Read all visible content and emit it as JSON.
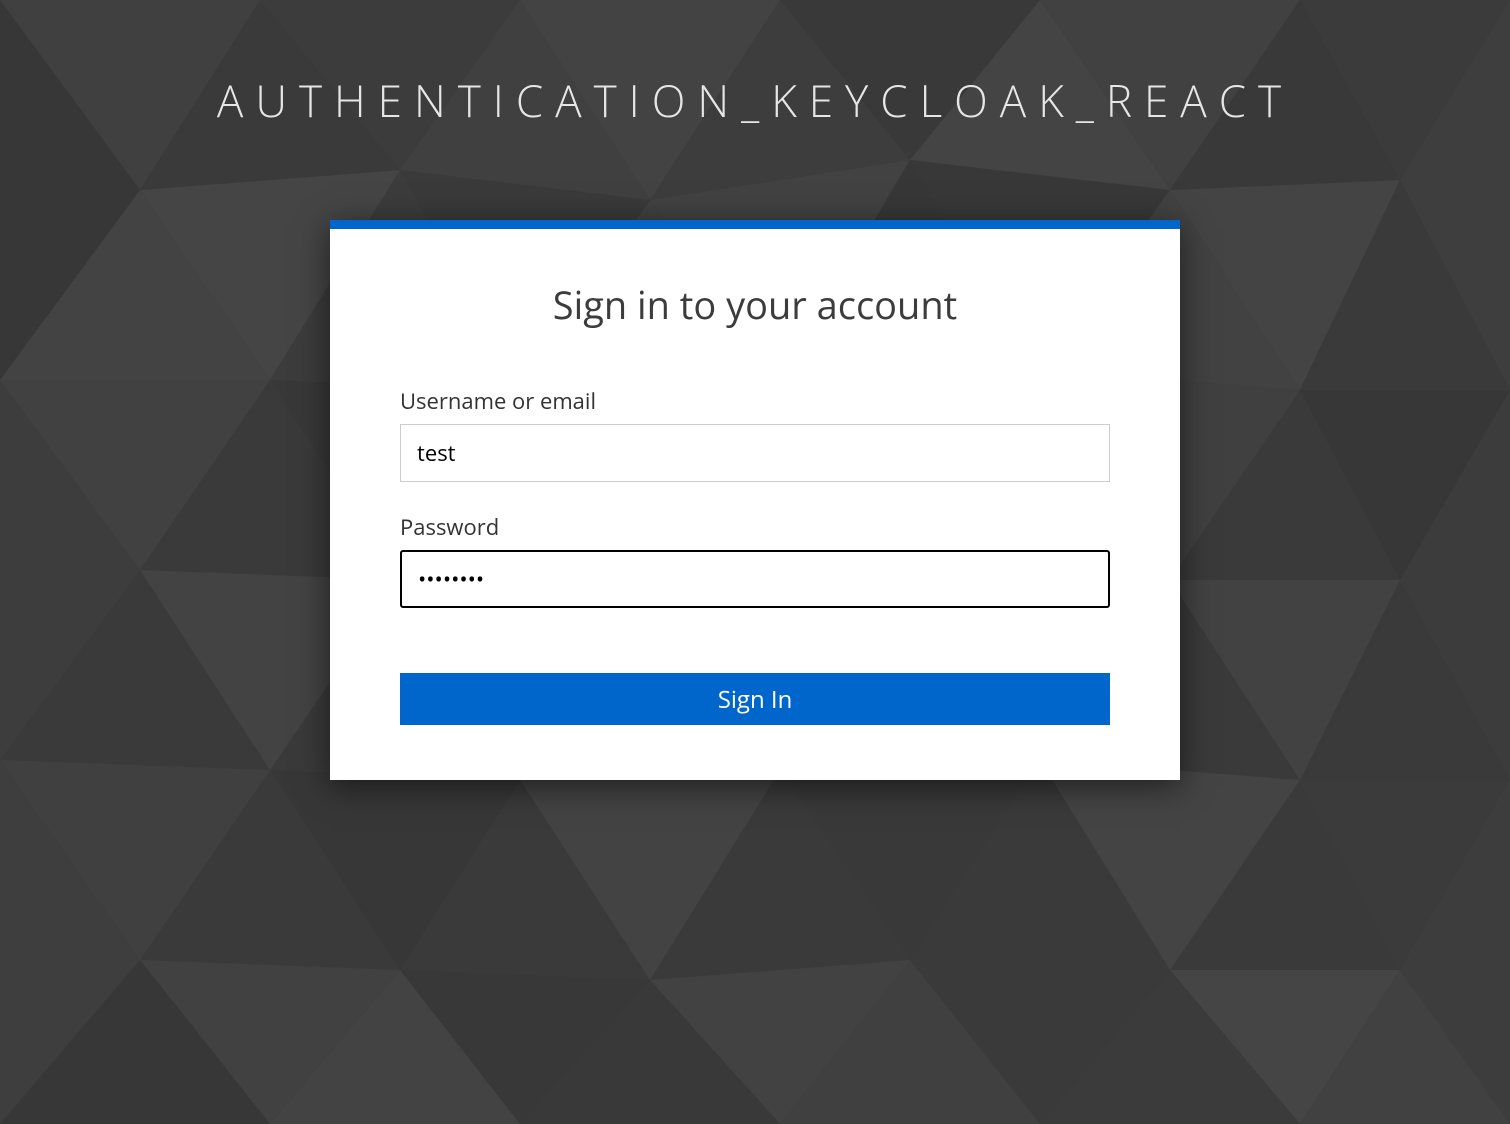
{
  "realm": {
    "title": "AUTHENTICATION_KEYCLOAK_REACT"
  },
  "card": {
    "title": "Sign in to your account"
  },
  "form": {
    "username": {
      "label": "Username or email",
      "value": "test"
    },
    "password": {
      "label": "Password",
      "value": "••••••••"
    },
    "submit_label": "Sign In"
  },
  "colors": {
    "accent": "#0066cc",
    "background": "#3a3a3a"
  }
}
